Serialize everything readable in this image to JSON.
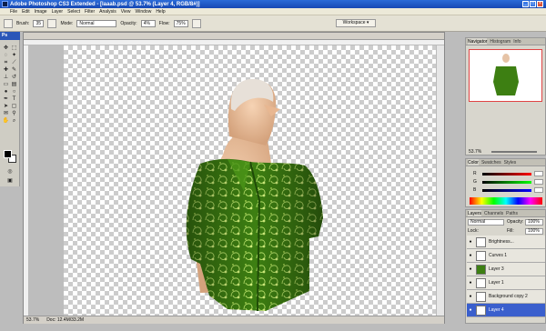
{
  "window": {
    "title": "Adobe Photoshop CS3 Extended - [laaab.psd @ 53.7% (Layer 4, RGB/8#)]"
  },
  "menu": [
    "File",
    "Edit",
    "Image",
    "Layer",
    "Select",
    "Filter",
    "Analysis",
    "View",
    "Window",
    "Help"
  ],
  "options": {
    "brush_label": "Brush:",
    "brush_size": "35",
    "mode_label": "Mode:",
    "mode_value": "Normal",
    "opacity_label": "Opacity:",
    "opacity_value": "4%",
    "flow_label": "Flow:",
    "flow_value": "75%",
    "workspace": "Workspace ▾"
  },
  "toolbox": {
    "title": "Ps"
  },
  "status": {
    "zoom": "53.7%",
    "doc": "Doc: 12.4M/33.2M"
  },
  "navigator": {
    "tabs": [
      "Navigator",
      "Histogram",
      "Info"
    ],
    "zoom": "53.7%"
  },
  "color_panel": {
    "tabs": [
      "Color",
      "Swatches",
      "Styles"
    ],
    "r_label": "R",
    "r_value": "",
    "g_label": "G",
    "g_value": "",
    "b_label": "B",
    "b_value": ""
  },
  "layers_panel": {
    "tabs": [
      "Layers",
      "Channels",
      "Paths"
    ],
    "blend": "Normal",
    "opacity_label": "Opacity:",
    "opacity": "100%",
    "lock_label": "Lock:",
    "fill_label": "Fill:",
    "fill": "100%",
    "layers": [
      "Brightness...",
      "Curves 1",
      "Layer 3",
      "Layer 1",
      "Background copy 2",
      "Layer 4"
    ]
  }
}
